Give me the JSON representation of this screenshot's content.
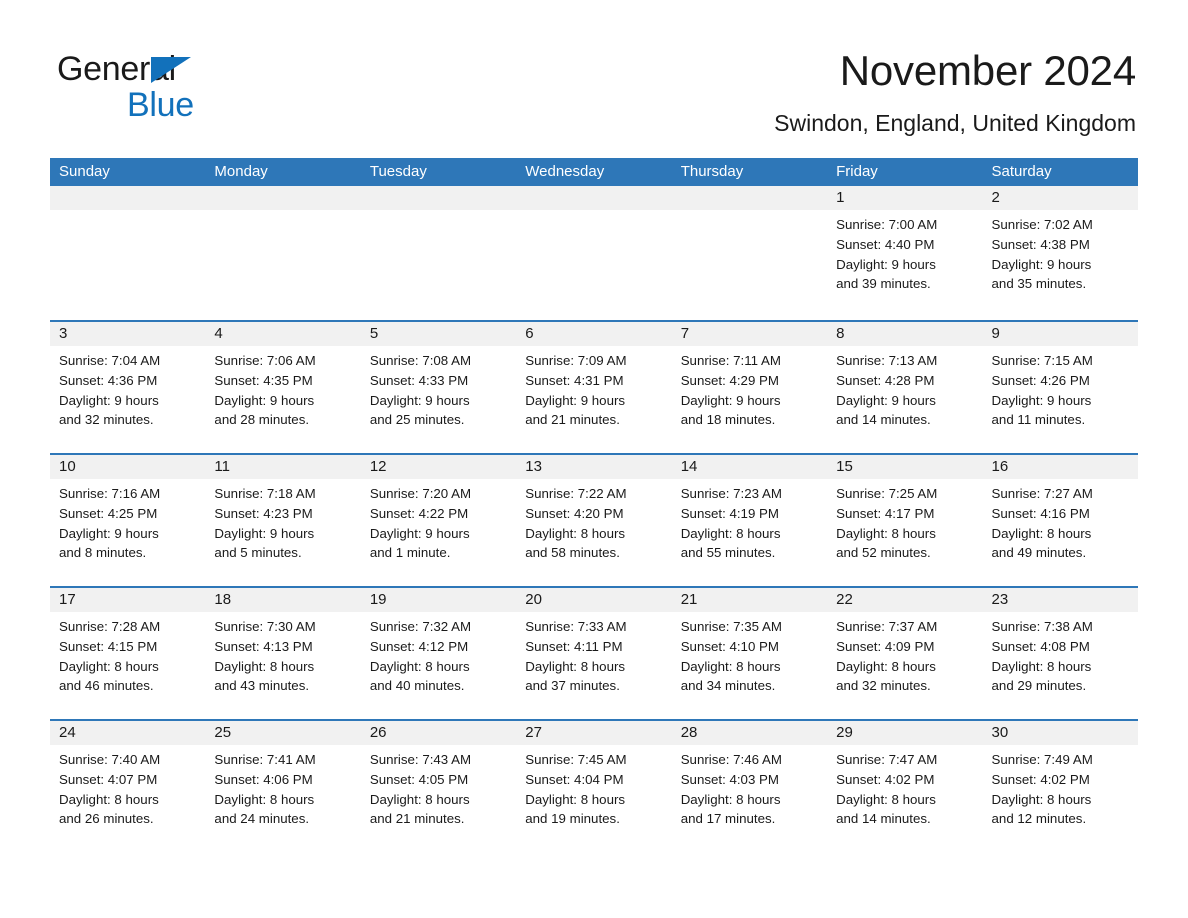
{
  "brand": {
    "name_part1": "General",
    "name_part2": "Blue",
    "triangle_color": "#1271bb"
  },
  "header": {
    "title": "November 2024",
    "location": "Swindon, England, United Kingdom"
  },
  "theme": {
    "header_blue": "#2e77b8",
    "day_band_gray": "#f1f1f1",
    "text_color": "#1a1a1a",
    "page_background": "#ffffff"
  },
  "weekdays": [
    "Sunday",
    "Monday",
    "Tuesday",
    "Wednesday",
    "Thursday",
    "Friday",
    "Saturday"
  ],
  "weeks": [
    [
      {
        "day": "",
        "lines": []
      },
      {
        "day": "",
        "lines": []
      },
      {
        "day": "",
        "lines": []
      },
      {
        "day": "",
        "lines": []
      },
      {
        "day": "",
        "lines": []
      },
      {
        "day": "1",
        "lines": [
          "Sunrise: 7:00 AM",
          "Sunset: 4:40 PM",
          "Daylight: 9 hours",
          "and 39 minutes."
        ]
      },
      {
        "day": "2",
        "lines": [
          "Sunrise: 7:02 AM",
          "Sunset: 4:38 PM",
          "Daylight: 9 hours",
          "and 35 minutes."
        ]
      }
    ],
    [
      {
        "day": "3",
        "lines": [
          "Sunrise: 7:04 AM",
          "Sunset: 4:36 PM",
          "Daylight: 9 hours",
          "and 32 minutes."
        ]
      },
      {
        "day": "4",
        "lines": [
          "Sunrise: 7:06 AM",
          "Sunset: 4:35 PM",
          "Daylight: 9 hours",
          "and 28 minutes."
        ]
      },
      {
        "day": "5",
        "lines": [
          "Sunrise: 7:08 AM",
          "Sunset: 4:33 PM",
          "Daylight: 9 hours",
          "and 25 minutes."
        ]
      },
      {
        "day": "6",
        "lines": [
          "Sunrise: 7:09 AM",
          "Sunset: 4:31 PM",
          "Daylight: 9 hours",
          "and 21 minutes."
        ]
      },
      {
        "day": "7",
        "lines": [
          "Sunrise: 7:11 AM",
          "Sunset: 4:29 PM",
          "Daylight: 9 hours",
          "and 18 minutes."
        ]
      },
      {
        "day": "8",
        "lines": [
          "Sunrise: 7:13 AM",
          "Sunset: 4:28 PM",
          "Daylight: 9 hours",
          "and 14 minutes."
        ]
      },
      {
        "day": "9",
        "lines": [
          "Sunrise: 7:15 AM",
          "Sunset: 4:26 PM",
          "Daylight: 9 hours",
          "and 11 minutes."
        ]
      }
    ],
    [
      {
        "day": "10",
        "lines": [
          "Sunrise: 7:16 AM",
          "Sunset: 4:25 PM",
          "Daylight: 9 hours",
          "and 8 minutes."
        ]
      },
      {
        "day": "11",
        "lines": [
          "Sunrise: 7:18 AM",
          "Sunset: 4:23 PM",
          "Daylight: 9 hours",
          "and 5 minutes."
        ]
      },
      {
        "day": "12",
        "lines": [
          "Sunrise: 7:20 AM",
          "Sunset: 4:22 PM",
          "Daylight: 9 hours",
          "and 1 minute."
        ]
      },
      {
        "day": "13",
        "lines": [
          "Sunrise: 7:22 AM",
          "Sunset: 4:20 PM",
          "Daylight: 8 hours",
          "and 58 minutes."
        ]
      },
      {
        "day": "14",
        "lines": [
          "Sunrise: 7:23 AM",
          "Sunset: 4:19 PM",
          "Daylight: 8 hours",
          "and 55 minutes."
        ]
      },
      {
        "day": "15",
        "lines": [
          "Sunrise: 7:25 AM",
          "Sunset: 4:17 PM",
          "Daylight: 8 hours",
          "and 52 minutes."
        ]
      },
      {
        "day": "16",
        "lines": [
          "Sunrise: 7:27 AM",
          "Sunset: 4:16 PM",
          "Daylight: 8 hours",
          "and 49 minutes."
        ]
      }
    ],
    [
      {
        "day": "17",
        "lines": [
          "Sunrise: 7:28 AM",
          "Sunset: 4:15 PM",
          "Daylight: 8 hours",
          "and 46 minutes."
        ]
      },
      {
        "day": "18",
        "lines": [
          "Sunrise: 7:30 AM",
          "Sunset: 4:13 PM",
          "Daylight: 8 hours",
          "and 43 minutes."
        ]
      },
      {
        "day": "19",
        "lines": [
          "Sunrise: 7:32 AM",
          "Sunset: 4:12 PM",
          "Daylight: 8 hours",
          "and 40 minutes."
        ]
      },
      {
        "day": "20",
        "lines": [
          "Sunrise: 7:33 AM",
          "Sunset: 4:11 PM",
          "Daylight: 8 hours",
          "and 37 minutes."
        ]
      },
      {
        "day": "21",
        "lines": [
          "Sunrise: 7:35 AM",
          "Sunset: 4:10 PM",
          "Daylight: 8 hours",
          "and 34 minutes."
        ]
      },
      {
        "day": "22",
        "lines": [
          "Sunrise: 7:37 AM",
          "Sunset: 4:09 PM",
          "Daylight: 8 hours",
          "and 32 minutes."
        ]
      },
      {
        "day": "23",
        "lines": [
          "Sunrise: 7:38 AM",
          "Sunset: 4:08 PM",
          "Daylight: 8 hours",
          "and 29 minutes."
        ]
      }
    ],
    [
      {
        "day": "24",
        "lines": [
          "Sunrise: 7:40 AM",
          "Sunset: 4:07 PM",
          "Daylight: 8 hours",
          "and 26 minutes."
        ]
      },
      {
        "day": "25",
        "lines": [
          "Sunrise: 7:41 AM",
          "Sunset: 4:06 PM",
          "Daylight: 8 hours",
          "and 24 minutes."
        ]
      },
      {
        "day": "26",
        "lines": [
          "Sunrise: 7:43 AM",
          "Sunset: 4:05 PM",
          "Daylight: 8 hours",
          "and 21 minutes."
        ]
      },
      {
        "day": "27",
        "lines": [
          "Sunrise: 7:45 AM",
          "Sunset: 4:04 PM",
          "Daylight: 8 hours",
          "and 19 minutes."
        ]
      },
      {
        "day": "28",
        "lines": [
          "Sunrise: 7:46 AM",
          "Sunset: 4:03 PM",
          "Daylight: 8 hours",
          "and 17 minutes."
        ]
      },
      {
        "day": "29",
        "lines": [
          "Sunrise: 7:47 AM",
          "Sunset: 4:02 PM",
          "Daylight: 8 hours",
          "and 14 minutes."
        ]
      },
      {
        "day": "30",
        "lines": [
          "Sunrise: 7:49 AM",
          "Sunset: 4:02 PM",
          "Daylight: 8 hours",
          "and 12 minutes."
        ]
      }
    ]
  ]
}
